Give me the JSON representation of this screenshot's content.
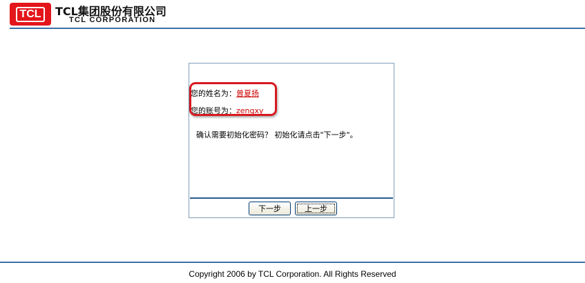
{
  "header": {
    "logo_text": "TCL",
    "company_name_cn": "TCL集团股份有限公司",
    "company_name_en": "TCL CORPORATION",
    "accent_color": "#e3161b",
    "rule_color": "#3a6ea5"
  },
  "dialog": {
    "name_label": "您的姓名为：",
    "name_value": "曾夏扬",
    "account_label": "您的账号为：",
    "account_value": "zengxy",
    "confirm_message": "确认需要初始化密码？ 初始化请点击\"下一步\"。",
    "next_button": "下一步",
    "prev_button": "上一步",
    "highlight_color": "#d81820"
  },
  "footer": {
    "copyright": "Copyright 2006 by TCL Corporation. All Rights Reserved"
  }
}
